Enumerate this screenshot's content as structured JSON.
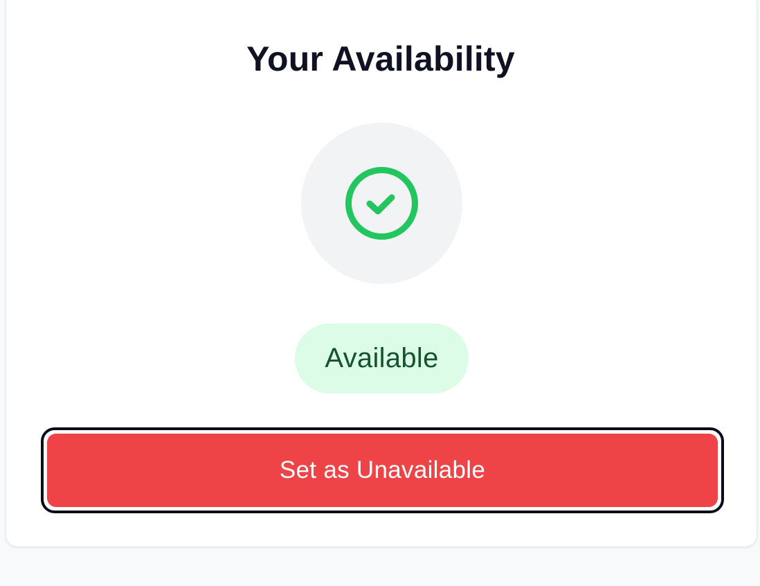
{
  "card": {
    "title": "Your Availability"
  },
  "status": {
    "icon": "check-circle-icon",
    "badge_label": "Available",
    "colors": {
      "icon": "#22c55e",
      "badge_bg": "#dcfce7",
      "badge_text": "#14532d"
    }
  },
  "actions": {
    "toggle_label": "Set as Unavailable",
    "toggle_color": "#ef4447"
  }
}
